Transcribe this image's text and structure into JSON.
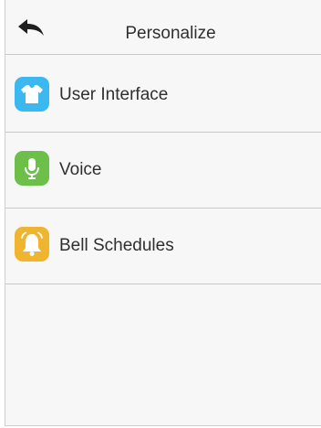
{
  "header": {
    "title": "Personalize",
    "back_icon": "back-arrow-icon"
  },
  "menu": {
    "items": [
      {
        "label": "User Interface",
        "icon": "shirt-icon",
        "color": "#3bb8f0"
      },
      {
        "label": "Voice",
        "icon": "microphone-icon",
        "color": "#6cc04a"
      },
      {
        "label": "Bell Schedules",
        "icon": "bell-icon",
        "color": "#f0b52e"
      }
    ]
  }
}
